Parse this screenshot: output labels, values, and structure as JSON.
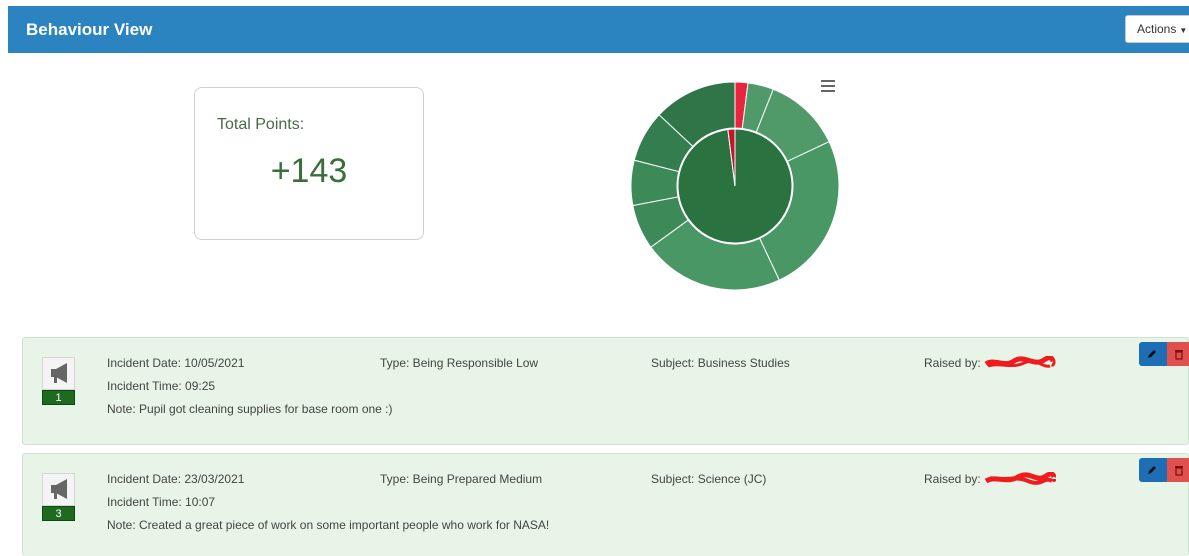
{
  "header": {
    "title": "Behaviour View",
    "actions_label": "Actions"
  },
  "summary": {
    "label": "Total Points:",
    "value": "+143"
  },
  "chart_data": {
    "type": "pie",
    "inner_ring": [
      {
        "value": 98,
        "color": "#2a7240"
      },
      {
        "value": 2,
        "color": "#c0172b"
      }
    ],
    "outer_ring": [
      {
        "value": 2,
        "color": "#e8243f"
      },
      {
        "value": 4,
        "color": "#4f9a68"
      },
      {
        "value": 12,
        "color": "#4f9a68"
      },
      {
        "value": 25,
        "color": "#4a9766"
      },
      {
        "value": 22,
        "color": "#4a9766"
      },
      {
        "value": 7,
        "color": "#3d8a58"
      },
      {
        "value": 7,
        "color": "#3d8a58"
      },
      {
        "value": 8,
        "color": "#347d4e"
      },
      {
        "value": 13,
        "color": "#2f7547"
      }
    ]
  },
  "incidents": [
    {
      "date": "Incident Date: 10/05/2021",
      "time": "Incident Time: 09:25",
      "note": "Note: Pupil got cleaning supplies for base room one :)",
      "type": "Type: Being Responsible Low",
      "subject": "Subject: Business Studies",
      "raised_by": "Raised by:",
      "points": "1"
    },
    {
      "date": "Incident Date: 23/03/2021",
      "time": "Incident Time: 10:07",
      "note": "Note: Created a great piece of work on some important people who work for NASA!",
      "type": "Type: Being Prepared Medium",
      "subject": "Subject: Science (JC)",
      "raised_by": "Raised by:",
      "points": "3"
    }
  ],
  "icons": {
    "incident": "megaphone-icon",
    "edit": "pencil-icon",
    "delete": "trash-icon",
    "chart_menu": "hamburger-menu-icon"
  }
}
